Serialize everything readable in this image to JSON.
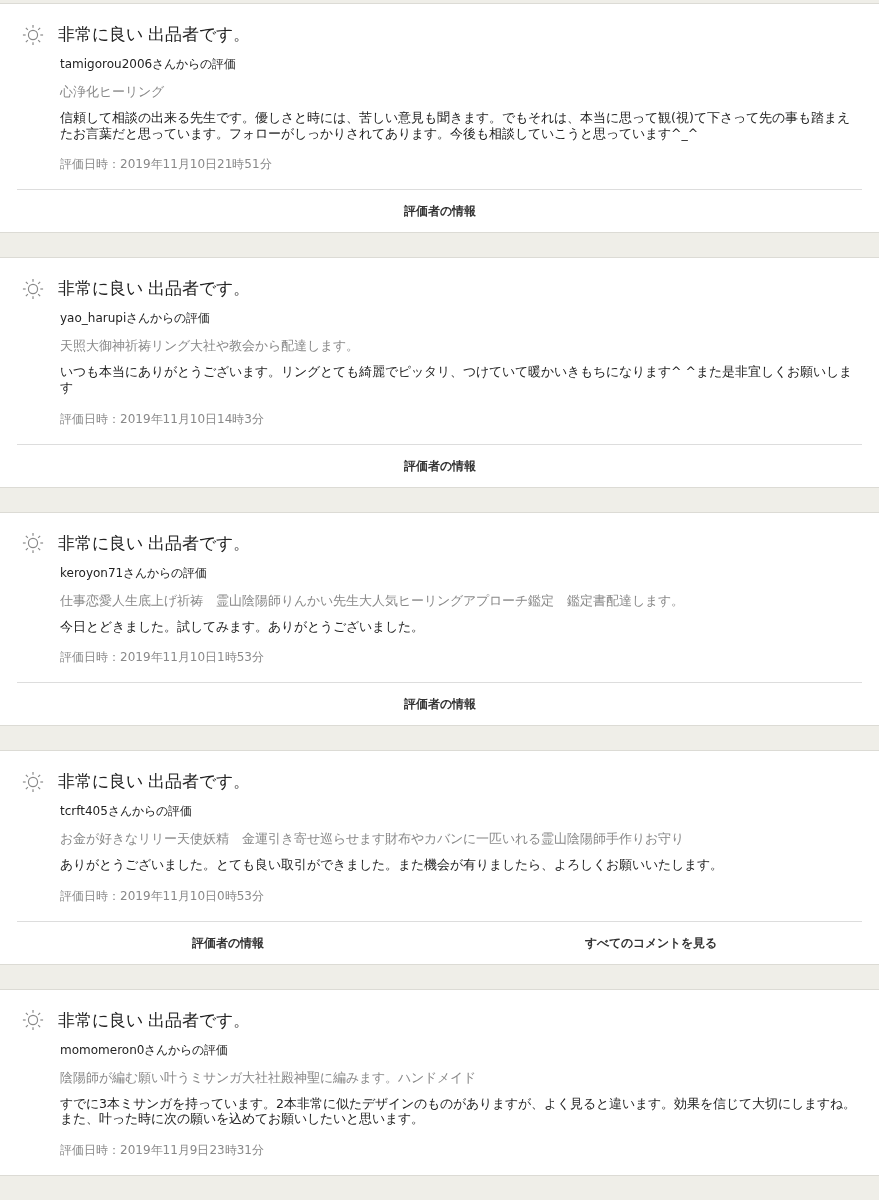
{
  "reviews": [
    {
      "rating": "非常に良い 出品者です。",
      "reviewer": "tamigorou2006さんからの評価",
      "product": "心浄化ヒーリング",
      "comment": "信頼して相談の出来る先生です。優しさと時には、苦しい意見も聞きます。でもそれは、本当に思って観(視)て下さって先の事も踏まえたお言葉だと思っています。フォローがしっかりされてあります。今後も相談していこうと思っています^_^",
      "date": "評価日時：2019年11月10日21時51分",
      "buttons": [
        "評価者の情報"
      ]
    },
    {
      "rating": "非常に良い 出品者です。",
      "reviewer": "yao_harupiさんからの評価",
      "product": "天照大御神祈祷リング大社や教会から配達します。",
      "comment": "いつも本当にありがとうございます。リングとても綺麗でピッタリ、つけていて暖かいきもちになります^ ^また是非宜しくお願いします",
      "date": "評価日時：2019年11月10日14時3分",
      "buttons": [
        "評価者の情報"
      ]
    },
    {
      "rating": "非常に良い 出品者です。",
      "reviewer": "keroyon71さんからの評価",
      "product": "仕事恋愛人生底上げ祈祷　霊山陰陽師りんかい先生大人気ヒーリングアプローチ鑑定　鑑定書配達します。",
      "comment": "今日とどきました。試してみます。ありがとうございました。",
      "date": "評価日時：2019年11月10日1時53分",
      "buttons": [
        "評価者の情報"
      ]
    },
    {
      "rating": "非常に良い 出品者です。",
      "reviewer": "tcrft405さんからの評価",
      "product": "お金が好きなリリー天使妖精　金運引き寄せ巡らせます財布やカバンに一匹いれる霊山陰陽師手作りお守り",
      "comment": "ありがとうございました。とても良い取引ができました。また機会が有りましたら、よろしくお願いいたします。",
      "date": "評価日時：2019年11月10日0時53分",
      "buttons": [
        "評価者の情報",
        "すべてのコメントを見る"
      ]
    },
    {
      "rating": "非常に良い 出品者です。",
      "reviewer": "momomeron0さんからの評価",
      "product": "陰陽師が編む願い叶うミサンガ大社社殿神聖に編みます。ハンドメイド",
      "comment": "すでに3本ミサンガを持っています。2本非常に似たデザインのものがありますが、よく見ると違います。効果を信じて大切にしますね。また、叶った時に次の願いを込めてお願いしたいと思います。",
      "date": "評価日時：2019年11月9日23時31分"
    }
  ]
}
